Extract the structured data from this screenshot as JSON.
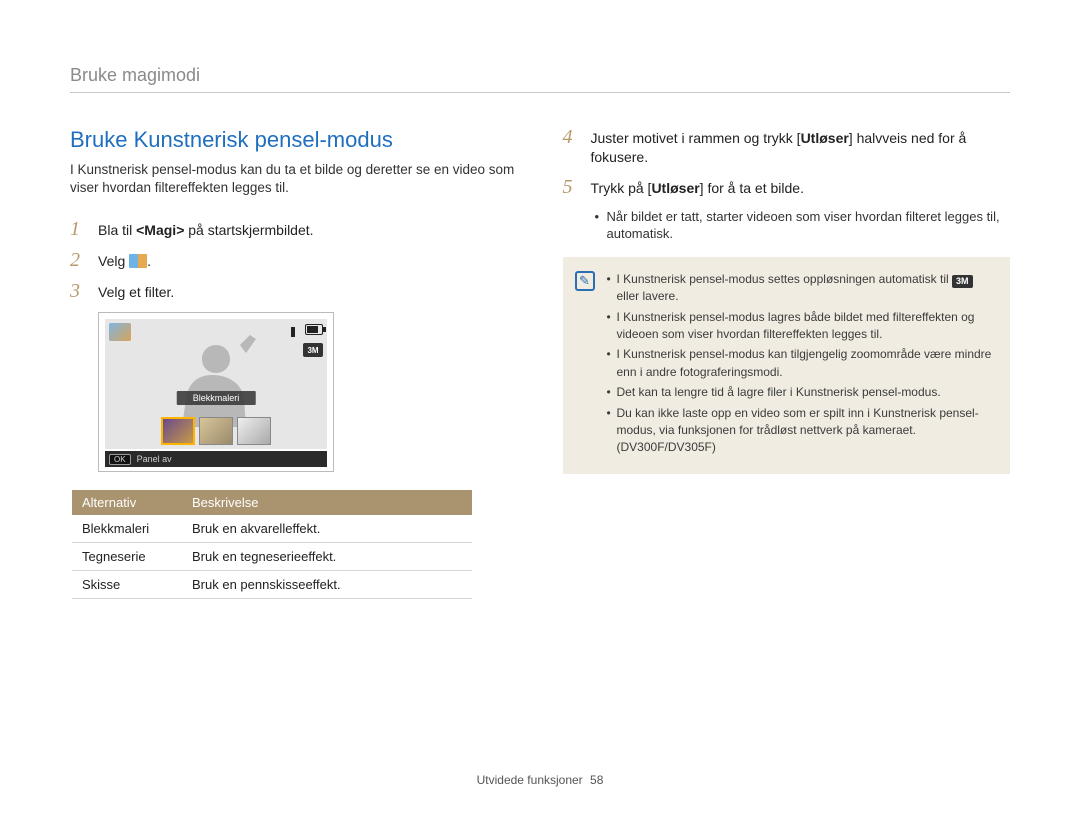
{
  "chapter": "Bruke magimodi",
  "title": "Bruke Kunstnerisk pensel-modus",
  "intro": "I Kunstnerisk pensel-modus kan du ta et bilde og deretter se en video som viser hvordan filtereffekten legges til.",
  "steps_left": [
    {
      "n": "1",
      "pre": "Bla til ",
      "bold": "<Magi>",
      "post": " på startskjermbildet."
    },
    {
      "n": "2",
      "pre": "Velg ",
      "icon": true,
      "post": "."
    },
    {
      "n": "3",
      "pre": "Velg et filter.",
      "post": ""
    }
  ],
  "screen": {
    "filter_label": "Blekkmaleri",
    "res_badge": "3M",
    "footer_btn": "OK",
    "footer_text": "Panel av"
  },
  "table": {
    "head": [
      "Alternativ",
      "Beskrivelse"
    ],
    "rows": [
      [
        "Blekkmaleri",
        "Bruk en akvarelleffekt."
      ],
      [
        "Tegneserie",
        "Bruk en tegneserieeffekt."
      ],
      [
        "Skisse",
        "Bruk en pennskisseeffekt."
      ]
    ]
  },
  "steps_right": [
    {
      "n": "4",
      "parts": [
        "Juster motivet i rammen og trykk [",
        "Utløser",
        "] halvveis ned for å fokusere."
      ]
    },
    {
      "n": "5",
      "parts": [
        "Trykk på [",
        "Utløser",
        "] for å ta et bilde."
      ],
      "bullet": "Når bildet er tatt, starter videoen som viser hvordan filteret legges til, automatisk."
    }
  ],
  "info": {
    "res_chip": "3M",
    "items": [
      {
        "pre": "I Kunstnerisk pensel-modus settes oppløsningen automatisk til ",
        "chip": true,
        "post": " eller lavere."
      },
      {
        "pre": "I Kunstnerisk pensel-modus lagres både bildet med filtereffekten og videoen som viser hvordan filtereffekten legges til."
      },
      {
        "pre": "I Kunstnerisk pensel-modus kan tilgjengelig zoomområde være mindre enn i andre fotograferingsmodi."
      },
      {
        "pre": "Det kan ta lengre tid å lagre filer i Kunstnerisk pensel-modus."
      },
      {
        "pre": "Du kan ikke laste opp en video som er spilt inn i Kunstnerisk pensel-modus, via funksjonen for trådløst nettverk på kameraet. (DV300F/DV305F)"
      }
    ]
  },
  "footer": {
    "label": "Utvidede funksjoner",
    "page": "58"
  }
}
